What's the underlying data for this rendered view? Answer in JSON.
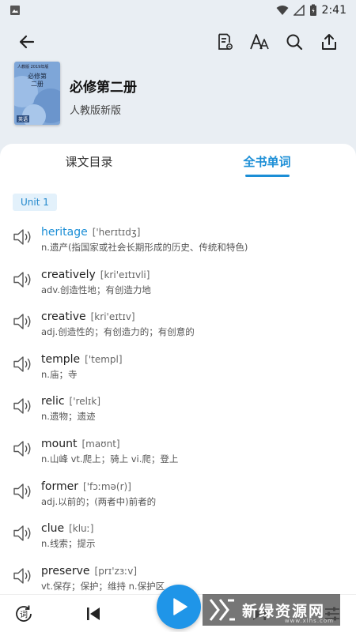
{
  "status_bar": {
    "time": "2:41"
  },
  "colors": {
    "accent": "#1b8ed6",
    "play": "#1f95e8"
  },
  "book": {
    "title": "必修第二册",
    "publisher": "人教版新版",
    "cover": {
      "top_text": "人教版 2019年版",
      "title": "必修第二册",
      "tag": "英语"
    }
  },
  "tabs": [
    {
      "label": "课文目录",
      "active": false
    },
    {
      "label": "全书单词",
      "active": true
    }
  ],
  "unit_label": "Unit 1",
  "words": [
    {
      "word": "heritage",
      "phonetic": "['herɪtɪdʒ]",
      "definition": "n.遗产(指国家或社会长期形成的历史、传统和特色)"
    },
    {
      "word": "creatively",
      "phonetic": "[kri'eɪtɪvli]",
      "definition": "adv.创造性地；有创造力地"
    },
    {
      "word": "creative",
      "phonetic": "[kri'eɪtɪv]",
      "definition": "adj.创造性的；有创造力的；有创意的"
    },
    {
      "word": "temple",
      "phonetic": "['templ]",
      "definition": "n.庙；寺"
    },
    {
      "word": "relic",
      "phonetic": "['relɪk]",
      "definition": "n.遗物；遗迹"
    },
    {
      "word": "mount",
      "phonetic": "[maʊnt]",
      "definition": "n.山峰  vt.爬上；骑上  vi.爬；登上"
    },
    {
      "word": "former",
      "phonetic": "['fɔːmə(r)]",
      "definition": "adj.以前的；(两者中)前者的"
    },
    {
      "word": "clue",
      "phonetic": "[kluː]",
      "definition": "n.线索；提示"
    },
    {
      "word": "preserve",
      "phonetic": "[prɪ'zɜːv]",
      "definition": "vt.保存；保护；维持  n.保护区"
    }
  ],
  "bottom_bar": {
    "vocab_icon_char": "词"
  },
  "watermark": {
    "text": "新绿资源网",
    "url": "www.xlhs.com"
  },
  "icons": [
    "back-arrow-icon",
    "note-edit-icon",
    "font-size-icon",
    "search-icon",
    "share-icon",
    "speaker-icon",
    "vocab-loop-icon",
    "previous-icon",
    "play-icon",
    "next-icon",
    "settings-sliders-icon"
  ]
}
